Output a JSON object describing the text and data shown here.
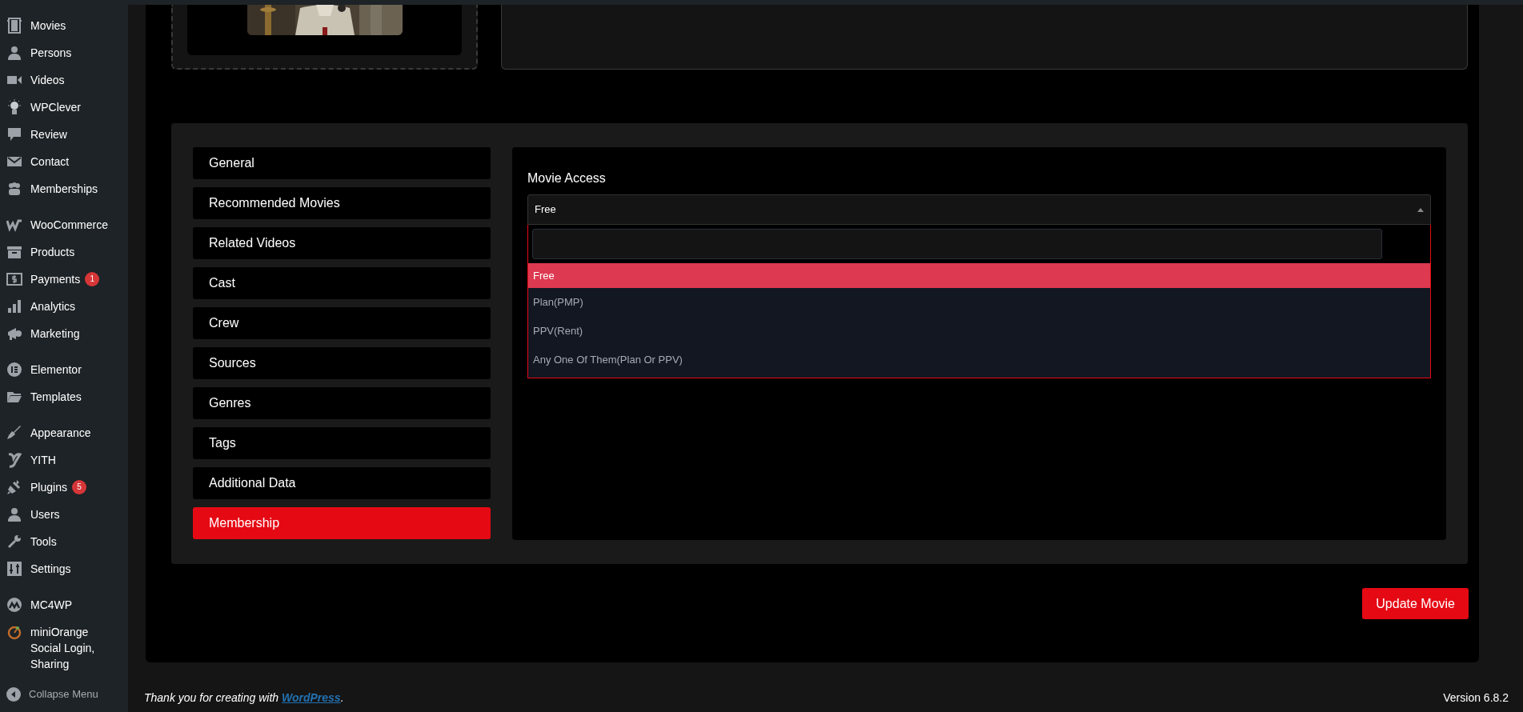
{
  "sidebar": {
    "groups": [
      [
        {
          "label": "Movies"
        },
        {
          "label": "Persons"
        },
        {
          "label": "Videos"
        },
        {
          "label": "WPClever"
        },
        {
          "label": "Review"
        },
        {
          "label": "Contact"
        },
        {
          "label": "Memberships"
        }
      ],
      [
        {
          "label": "WooCommerce"
        },
        {
          "label": "Products"
        },
        {
          "label": "Payments",
          "badge": "1"
        },
        {
          "label": "Analytics"
        },
        {
          "label": "Marketing"
        }
      ],
      [
        {
          "label": "Elementor"
        },
        {
          "label": "Templates"
        }
      ],
      [
        {
          "label": "Appearance"
        },
        {
          "label": "YITH"
        },
        {
          "label": "Plugins",
          "badge": "5"
        },
        {
          "label": "Users"
        },
        {
          "label": "Tools"
        },
        {
          "label": "Settings"
        }
      ],
      [
        {
          "label": "MC4WP"
        },
        {
          "label": "miniOrange Social Login, Sharing"
        }
      ]
    ],
    "collapse": "Collapse Menu"
  },
  "tabs": [
    {
      "label": "General",
      "selected": false
    },
    {
      "label": "Recommended Movies",
      "selected": false
    },
    {
      "label": "Related Videos",
      "selected": false
    },
    {
      "label": "Cast",
      "selected": false
    },
    {
      "label": "Crew",
      "selected": false
    },
    {
      "label": "Sources",
      "selected": false
    },
    {
      "label": "Genres",
      "selected": false
    },
    {
      "label": "Tags",
      "selected": false
    },
    {
      "label": "Additional Data",
      "selected": false
    },
    {
      "label": "Membership",
      "selected": true
    }
  ],
  "movie_access": {
    "label": "Movie Access",
    "value": "Free",
    "options": [
      {
        "label": "Free",
        "selected": true
      },
      {
        "label": "Plan(PMP)",
        "selected": false
      },
      {
        "label": "PPV(Rent)",
        "selected": false
      },
      {
        "label": "Any One Of Them(Plan Or PPV)",
        "selected": false
      }
    ]
  },
  "update_button": "Update Movie",
  "footer": {
    "text": "Thank you for creating with ",
    "link": "WordPress",
    "after": ".",
    "version": "Version 6.8.2"
  }
}
